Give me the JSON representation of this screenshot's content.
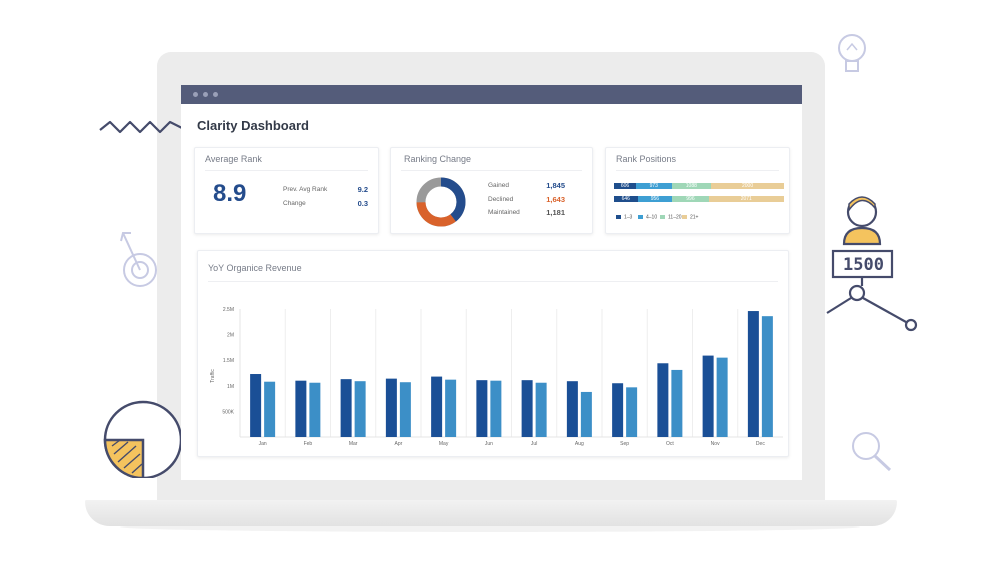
{
  "dashboard": {
    "title": "Clarity Dashboard"
  },
  "average_rank": {
    "title": "Average Rank",
    "value": "8.9",
    "prev_label": "Prev. Avg Rank",
    "prev_value": "9.2",
    "change_label": "Change",
    "change_value": "0.3"
  },
  "ranking_change": {
    "title": "Ranking Change",
    "gained_label": "Gained",
    "gained_value": "1,845",
    "declined_label": "Declined",
    "declined_value": "1,643",
    "maintained_label": "Maintained",
    "maintained_value": "1,181",
    "colors": {
      "gained": "#244c8c",
      "declined": "#d9622b",
      "maintained": "#9a9a9a"
    }
  },
  "rank_positions": {
    "title": "Rank Positions",
    "rows": [
      {
        "segments": [
          "606",
          "973",
          "1088",
          "2000"
        ]
      },
      {
        "segments": [
          "646",
          "956",
          "996",
          "2071"
        ]
      }
    ],
    "legend": [
      "1–3",
      "4–10",
      "11–20",
      "21+"
    ],
    "colors": [
      "#1f4e8c",
      "#3e9fd3",
      "#9fd7b7",
      "#e9cd97"
    ]
  },
  "revenue_chart": {
    "title": "YoY Organice Revenue",
    "colors": {
      "prev": "#1a4f96",
      "curr": "#3c8fc7"
    }
  },
  "chart_data": {
    "type": "bar",
    "ylabel": "Traffic",
    "yticks": [
      "500K",
      "1M",
      "1.5M",
      "2M",
      "2.5M"
    ],
    "ylim": [
      0,
      2500000
    ],
    "categories": [
      "Jan",
      "Feb",
      "Mar",
      "Apr",
      "May",
      "Jun",
      "Jul",
      "Aug",
      "Sep",
      "Oct",
      "Nov",
      "Dec"
    ],
    "series": [
      {
        "values": [
          1230000,
          1100000,
          1130000,
          1140000,
          1180000,
          1110000,
          1110000,
          1090000,
          1050000,
          1440000,
          1590000,
          2460000
        ]
      },
      {
        "values": [
          1080000,
          1060000,
          1090000,
          1070000,
          1120000,
          1100000,
          1060000,
          880000,
          970000,
          1310000,
          1550000,
          2360000
        ]
      }
    ]
  },
  "decor": {
    "badge_text": "1500"
  }
}
